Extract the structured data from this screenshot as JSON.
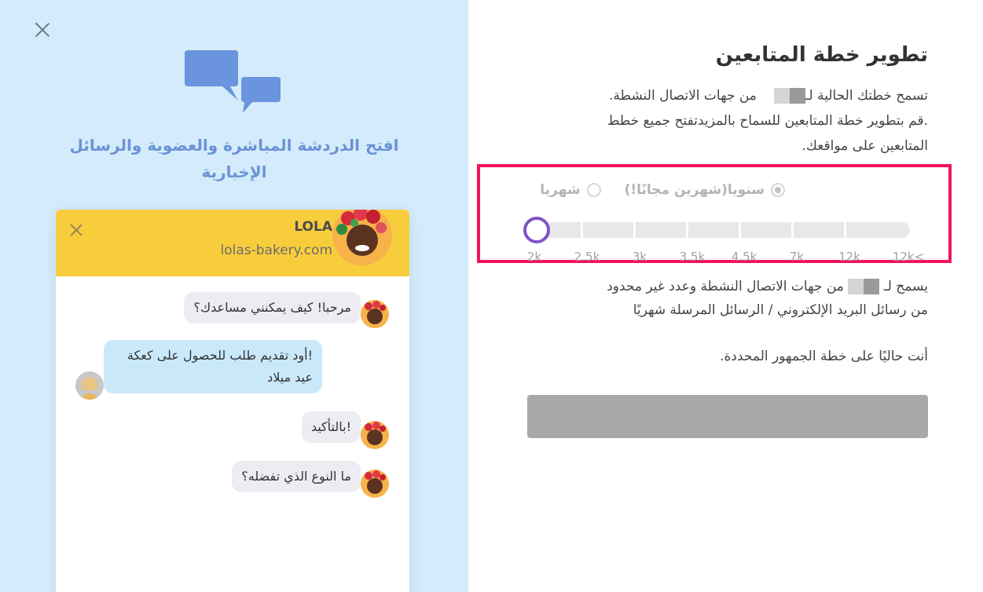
{
  "left_panel": {
    "title": "افتح الدردشة المباشرة والعضوية والرسائل الإخبارية",
    "widget": {
      "name": "LOLA",
      "site": "lolas-bakery.com",
      "messages": [
        {
          "from": "agent",
          "text": "مرحبا! كيف يمكنني مساعدك؟"
        },
        {
          "from": "user",
          "text": "!أود تقديم طلب للحصول على كعكة عيد ميلاد"
        },
        {
          "from": "agent",
          "text": "!بالتأكيد"
        },
        {
          "from": "agent",
          "text": "ما النوع الذي تفضله؟"
        }
      ]
    }
  },
  "right_panel": {
    "title": "تطوير خطة المتابعين",
    "desc_line1_a": "تسمح خطتك الحالية لـ",
    "desc_line1_b": "من جهات الاتصال النشطة.",
    "desc_line2": ".قم بتطوير خطة المتابعين للسماح بالمزيدتفتح جميع خطط",
    "desc_line3": "المتابعين على مواقعك.",
    "billing": {
      "yearly_label": "سنويا(شهرين مجانًا!)",
      "monthly_label": "شهريا",
      "selected": "yearly"
    },
    "slider": {
      "ticks": [
        "2k",
        "2.5k",
        "3k",
        "3.5k",
        "4.5k",
        "7k",
        "12k",
        "12k<"
      ],
      "selected_index": 0
    },
    "allows_a": "يسمح لـ",
    "allows_b": "من جهات الاتصال النشطة وعدد غير محدود",
    "allows_line2": "من رسائل البريد الإلكتروني / الرسائل المرسلة شهريًا",
    "current_plan_text": "أنت حاليًا على خطة الجمهور المحددة.",
    "action_button_label": ""
  }
}
